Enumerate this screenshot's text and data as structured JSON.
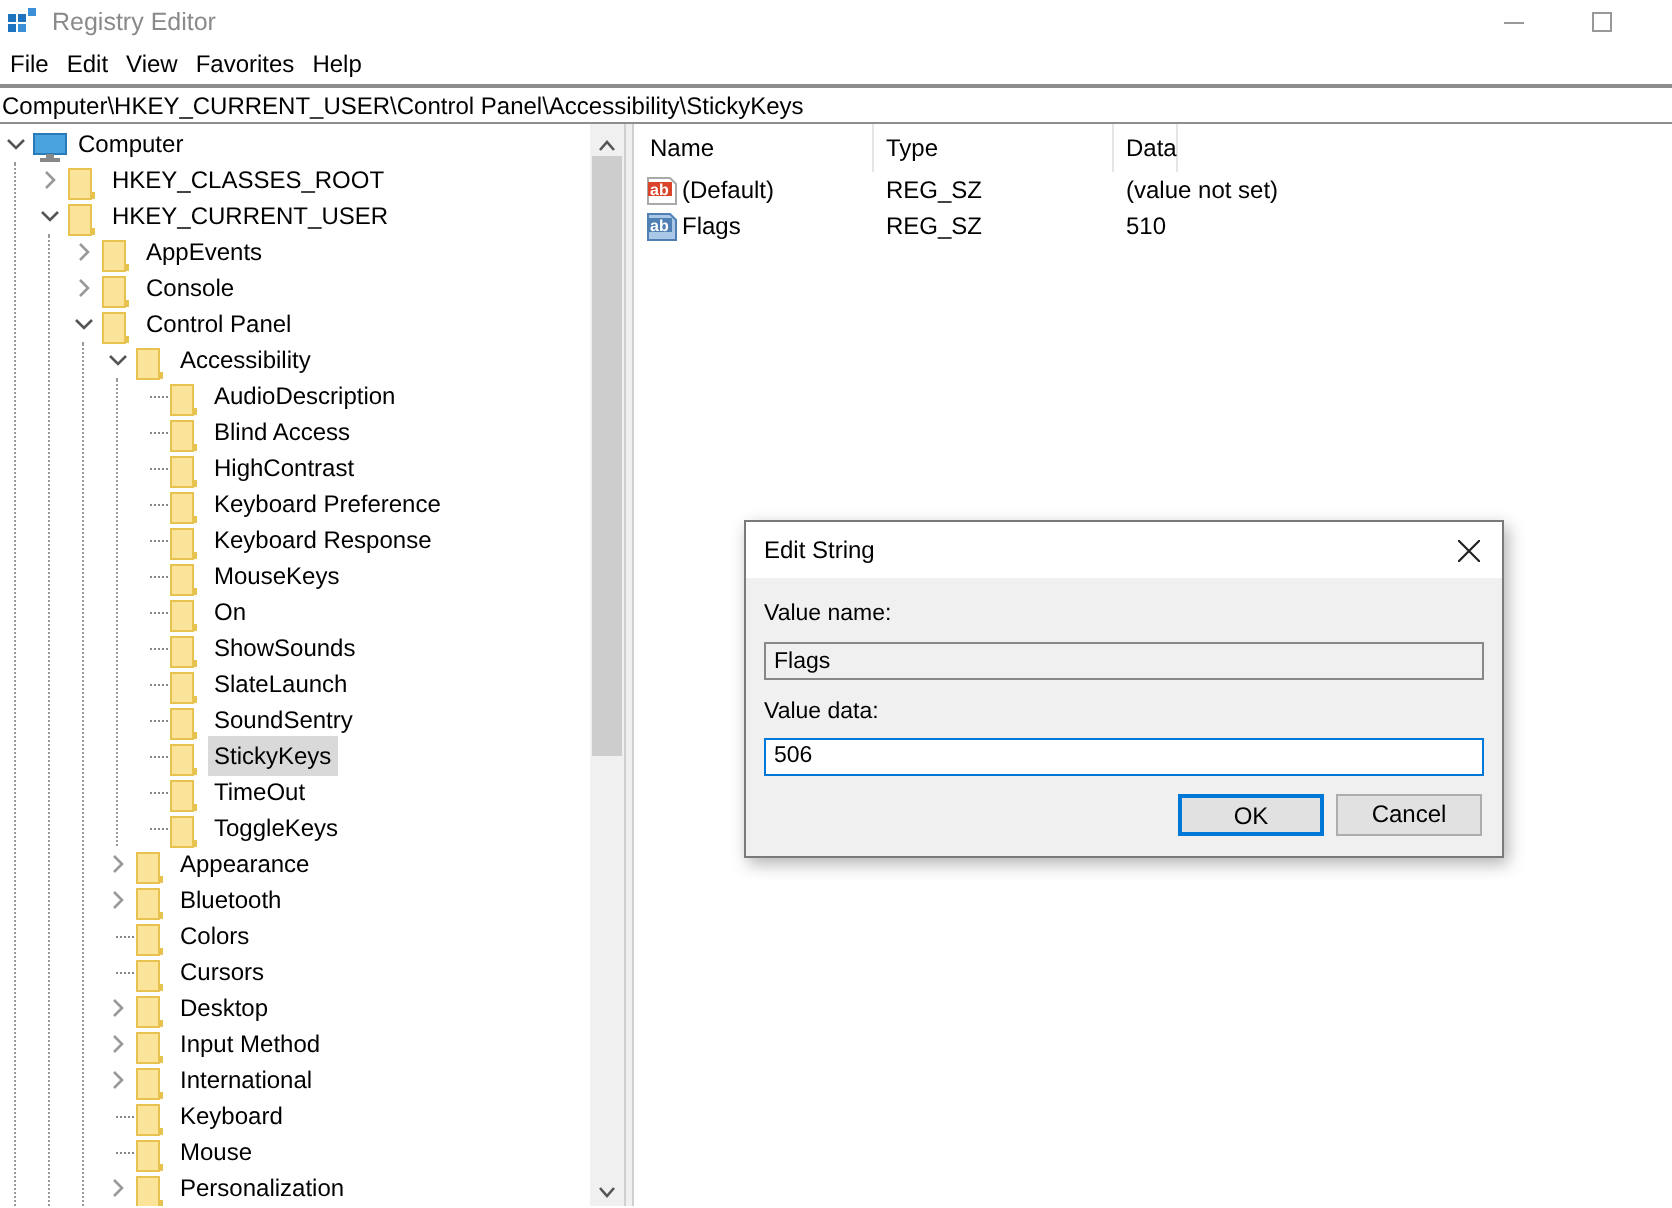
{
  "window": {
    "title": "Registry Editor"
  },
  "menu": [
    "File",
    "Edit",
    "View",
    "Favorites",
    "Help"
  ],
  "address": "Computer\\HKEY_CURRENT_USER\\Control Panel\\Accessibility\\StickyKeys",
  "tree": [
    {
      "label": "Computer",
      "kind": "computer",
      "expanded": true,
      "selected": false,
      "children": [
        {
          "label": "HKEY_CLASSES_ROOT",
          "kind": "folder",
          "expanded": false,
          "selected": false
        },
        {
          "label": "HKEY_CURRENT_USER",
          "kind": "folder",
          "expanded": true,
          "selected": false,
          "children": [
            {
              "label": "AppEvents",
              "kind": "folder",
              "expanded": false,
              "selected": false
            },
            {
              "label": "Console",
              "kind": "folder",
              "expanded": false,
              "selected": false
            },
            {
              "label": "Control Panel",
              "kind": "folder",
              "expanded": true,
              "selected": false,
              "children": [
                {
                  "label": "Accessibility",
                  "kind": "folder",
                  "expanded": true,
                  "selected": false,
                  "children": [
                    {
                      "label": "AudioDescription",
                      "kind": "folder",
                      "selected": false
                    },
                    {
                      "label": "Blind Access",
                      "kind": "folder",
                      "selected": false
                    },
                    {
                      "label": "HighContrast",
                      "kind": "folder",
                      "selected": false
                    },
                    {
                      "label": "Keyboard Preference",
                      "kind": "folder",
                      "selected": false
                    },
                    {
                      "label": "Keyboard Response",
                      "kind": "folder",
                      "selected": false
                    },
                    {
                      "label": "MouseKeys",
                      "kind": "folder",
                      "selected": false
                    },
                    {
                      "label": "On",
                      "kind": "folder",
                      "selected": false
                    },
                    {
                      "label": "ShowSounds",
                      "kind": "folder",
                      "selected": false
                    },
                    {
                      "label": "SlateLaunch",
                      "kind": "folder",
                      "selected": false
                    },
                    {
                      "label": "SoundSentry",
                      "kind": "folder",
                      "selected": false
                    },
                    {
                      "label": "StickyKeys",
                      "kind": "folder",
                      "selected": true
                    },
                    {
                      "label": "TimeOut",
                      "kind": "folder",
                      "selected": false
                    },
                    {
                      "label": "ToggleKeys",
                      "kind": "folder",
                      "selected": false
                    }
                  ]
                },
                {
                  "label": "Appearance",
                  "kind": "folder",
                  "expanded": false,
                  "selected": false
                },
                {
                  "label": "Bluetooth",
                  "kind": "folder",
                  "expanded": false,
                  "selected": false
                },
                {
                  "label": "Colors",
                  "kind": "folder",
                  "selected": false
                },
                {
                  "label": "Cursors",
                  "kind": "folder",
                  "selected": false
                },
                {
                  "label": "Desktop",
                  "kind": "folder",
                  "expanded": false,
                  "selected": false
                },
                {
                  "label": "Input Method",
                  "kind": "folder",
                  "expanded": false,
                  "selected": false
                },
                {
                  "label": "International",
                  "kind": "folder",
                  "expanded": false,
                  "selected": false
                },
                {
                  "label": "Keyboard",
                  "kind": "folder",
                  "selected": false
                },
                {
                  "label": "Mouse",
                  "kind": "folder",
                  "selected": false
                },
                {
                  "label": "Personalization",
                  "kind": "folder",
                  "expanded": false,
                  "selected": false
                }
              ]
            }
          ]
        }
      ]
    }
  ],
  "values": {
    "columns": [
      "Name",
      "Type",
      "Data"
    ],
    "rows": [
      {
        "name": "(Default)",
        "kind": "string-default",
        "icon_text": "ab",
        "type": "REG_SZ",
        "data": "(value not set)"
      },
      {
        "name": "Flags",
        "kind": "string",
        "icon_text": "ab",
        "type": "REG_SZ",
        "data": "510"
      }
    ]
  },
  "dialog": {
    "title": "Edit String",
    "name_label": "Value name:",
    "name_value": "Flags",
    "data_label": "Value data:",
    "data_value": "506",
    "buttons": [
      {
        "label": "OK",
        "default": true
      },
      {
        "label": "Cancel",
        "default": false
      }
    ]
  }
}
